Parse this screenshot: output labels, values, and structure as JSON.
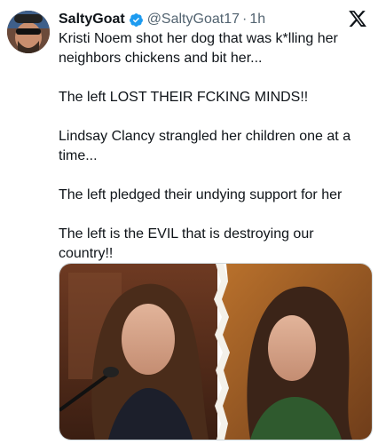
{
  "author": {
    "display_name": "SaltyGoat",
    "handle": "@SaltyGoat17",
    "separator": "·",
    "time": "1h"
  },
  "icons": {
    "verified": "verified-badge-icon",
    "platform": "x-logo-icon"
  },
  "colors": {
    "verified_blue": "#1d9bf0",
    "text_primary": "#0f1419",
    "text_secondary": "#536471"
  },
  "tweet": {
    "paragraphs": [
      "Kristi Noem shot her dog that was k*lling her neighbors chickens and bit her...",
      "The left LOST THEIR FCKING MINDS!!",
      "Lindsay Clancy strangled her children one at a time...",
      "The left pledged their undying support for her",
      "The left is the EVIL that is destroying our country!!"
    ]
  }
}
